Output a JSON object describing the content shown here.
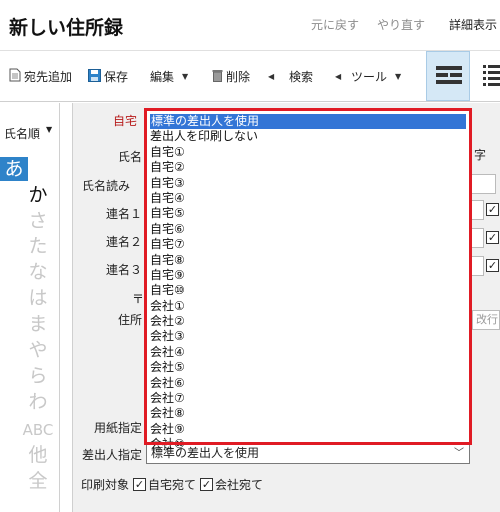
{
  "title": "新しい住所録",
  "header": {
    "undo": "元に戻す",
    "redo": "やり直す",
    "detail": "詳細表示"
  },
  "toolbar": {
    "add": "宛先追加",
    "save": "保存",
    "edit": "編集",
    "delete": "削除",
    "search": "検索",
    "tools": "ツール"
  },
  "sidebar": {
    "sort_label": "氏名順",
    "kana": [
      "あ",
      "か",
      "さ",
      "た",
      "な",
      "は",
      "ま",
      "や",
      "ら",
      "わ",
      "ABC",
      "他",
      "全"
    ]
  },
  "form": {
    "home_tab": "自宅",
    "labels": {
      "name": "氏名",
      "reading": "氏名読み",
      "joint1": "連名１",
      "joint2": "連名２",
      "joint3": "連名３",
      "postal": "〒",
      "address": "住所",
      "paper": "用紙指定",
      "sender": "差出人指定",
      "print_target": "印刷対象"
    },
    "right_partial_char": "字",
    "right_partial_btn": "改行",
    "sender_value": "標準の差出人を使用",
    "print_home": "自宅宛て",
    "print_company": "会社宛て"
  },
  "dropdown": {
    "options": [
      "標準の差出人を使用",
      "差出人を印刷しない",
      "自宅①",
      "自宅②",
      "自宅③",
      "自宅④",
      "自宅⑤",
      "自宅⑥",
      "自宅⑦",
      "自宅⑧",
      "自宅⑨",
      "自宅⑩",
      "会社①",
      "会社②",
      "会社③",
      "会社④",
      "会社⑤",
      "会社⑥",
      "会社⑦",
      "会社⑧",
      "会社⑨",
      "会社⑩"
    ],
    "selected_index": 0
  },
  "colors": {
    "accent": "#2e83c9",
    "highlight": "#e01b24",
    "selection": "#3375d6"
  }
}
